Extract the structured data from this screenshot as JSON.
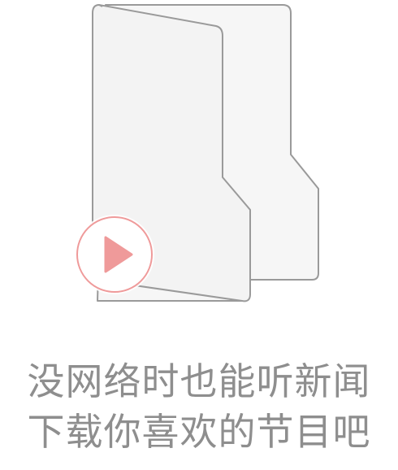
{
  "empty_state": {
    "illustration": {
      "folder_icon": "open-folder-icon",
      "play_icon": "play-circle-icon",
      "folder_fill": "#f5f5f5",
      "folder_stroke": "#999999",
      "play_stroke": "#ef9a9a",
      "play_fill": "#ef9a9a"
    },
    "message_line1": "没网络时也能听新闻",
    "message_line2": "下载你喜欢的节目吧"
  }
}
